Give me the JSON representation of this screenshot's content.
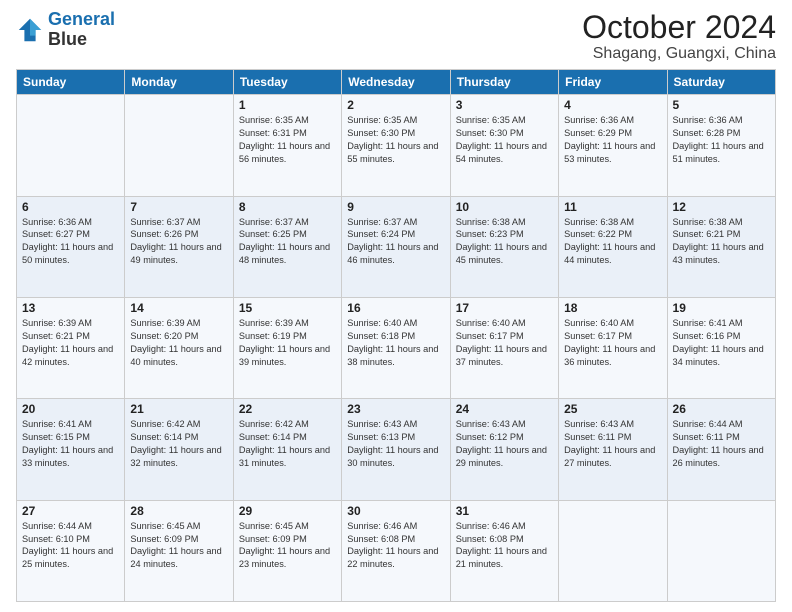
{
  "logo": {
    "line1": "General",
    "line2": "Blue"
  },
  "title": "October 2024",
  "location": "Shagang, Guangxi, China",
  "weekdays": [
    "Sunday",
    "Monday",
    "Tuesday",
    "Wednesday",
    "Thursday",
    "Friday",
    "Saturday"
  ],
  "weeks": [
    [
      {
        "day": "",
        "sunrise": "",
        "sunset": "",
        "daylight": ""
      },
      {
        "day": "",
        "sunrise": "",
        "sunset": "",
        "daylight": ""
      },
      {
        "day": "1",
        "sunrise": "Sunrise: 6:35 AM",
        "sunset": "Sunset: 6:31 PM",
        "daylight": "Daylight: 11 hours and 56 minutes."
      },
      {
        "day": "2",
        "sunrise": "Sunrise: 6:35 AM",
        "sunset": "Sunset: 6:30 PM",
        "daylight": "Daylight: 11 hours and 55 minutes."
      },
      {
        "day": "3",
        "sunrise": "Sunrise: 6:35 AM",
        "sunset": "Sunset: 6:30 PM",
        "daylight": "Daylight: 11 hours and 54 minutes."
      },
      {
        "day": "4",
        "sunrise": "Sunrise: 6:36 AM",
        "sunset": "Sunset: 6:29 PM",
        "daylight": "Daylight: 11 hours and 53 minutes."
      },
      {
        "day": "5",
        "sunrise": "Sunrise: 6:36 AM",
        "sunset": "Sunset: 6:28 PM",
        "daylight": "Daylight: 11 hours and 51 minutes."
      }
    ],
    [
      {
        "day": "6",
        "sunrise": "Sunrise: 6:36 AM",
        "sunset": "Sunset: 6:27 PM",
        "daylight": "Daylight: 11 hours and 50 minutes."
      },
      {
        "day": "7",
        "sunrise": "Sunrise: 6:37 AM",
        "sunset": "Sunset: 6:26 PM",
        "daylight": "Daylight: 11 hours and 49 minutes."
      },
      {
        "day": "8",
        "sunrise": "Sunrise: 6:37 AM",
        "sunset": "Sunset: 6:25 PM",
        "daylight": "Daylight: 11 hours and 48 minutes."
      },
      {
        "day": "9",
        "sunrise": "Sunrise: 6:37 AM",
        "sunset": "Sunset: 6:24 PM",
        "daylight": "Daylight: 11 hours and 46 minutes."
      },
      {
        "day": "10",
        "sunrise": "Sunrise: 6:38 AM",
        "sunset": "Sunset: 6:23 PM",
        "daylight": "Daylight: 11 hours and 45 minutes."
      },
      {
        "day": "11",
        "sunrise": "Sunrise: 6:38 AM",
        "sunset": "Sunset: 6:22 PM",
        "daylight": "Daylight: 11 hours and 44 minutes."
      },
      {
        "day": "12",
        "sunrise": "Sunrise: 6:38 AM",
        "sunset": "Sunset: 6:21 PM",
        "daylight": "Daylight: 11 hours and 43 minutes."
      }
    ],
    [
      {
        "day": "13",
        "sunrise": "Sunrise: 6:39 AM",
        "sunset": "Sunset: 6:21 PM",
        "daylight": "Daylight: 11 hours and 42 minutes."
      },
      {
        "day": "14",
        "sunrise": "Sunrise: 6:39 AM",
        "sunset": "Sunset: 6:20 PM",
        "daylight": "Daylight: 11 hours and 40 minutes."
      },
      {
        "day": "15",
        "sunrise": "Sunrise: 6:39 AM",
        "sunset": "Sunset: 6:19 PM",
        "daylight": "Daylight: 11 hours and 39 minutes."
      },
      {
        "day": "16",
        "sunrise": "Sunrise: 6:40 AM",
        "sunset": "Sunset: 6:18 PM",
        "daylight": "Daylight: 11 hours and 38 minutes."
      },
      {
        "day": "17",
        "sunrise": "Sunrise: 6:40 AM",
        "sunset": "Sunset: 6:17 PM",
        "daylight": "Daylight: 11 hours and 37 minutes."
      },
      {
        "day": "18",
        "sunrise": "Sunrise: 6:40 AM",
        "sunset": "Sunset: 6:17 PM",
        "daylight": "Daylight: 11 hours and 36 minutes."
      },
      {
        "day": "19",
        "sunrise": "Sunrise: 6:41 AM",
        "sunset": "Sunset: 6:16 PM",
        "daylight": "Daylight: 11 hours and 34 minutes."
      }
    ],
    [
      {
        "day": "20",
        "sunrise": "Sunrise: 6:41 AM",
        "sunset": "Sunset: 6:15 PM",
        "daylight": "Daylight: 11 hours and 33 minutes."
      },
      {
        "day": "21",
        "sunrise": "Sunrise: 6:42 AM",
        "sunset": "Sunset: 6:14 PM",
        "daylight": "Daylight: 11 hours and 32 minutes."
      },
      {
        "day": "22",
        "sunrise": "Sunrise: 6:42 AM",
        "sunset": "Sunset: 6:14 PM",
        "daylight": "Daylight: 11 hours and 31 minutes."
      },
      {
        "day": "23",
        "sunrise": "Sunrise: 6:43 AM",
        "sunset": "Sunset: 6:13 PM",
        "daylight": "Daylight: 11 hours and 30 minutes."
      },
      {
        "day": "24",
        "sunrise": "Sunrise: 6:43 AM",
        "sunset": "Sunset: 6:12 PM",
        "daylight": "Daylight: 11 hours and 29 minutes."
      },
      {
        "day": "25",
        "sunrise": "Sunrise: 6:43 AM",
        "sunset": "Sunset: 6:11 PM",
        "daylight": "Daylight: 11 hours and 27 minutes."
      },
      {
        "day": "26",
        "sunrise": "Sunrise: 6:44 AM",
        "sunset": "Sunset: 6:11 PM",
        "daylight": "Daylight: 11 hours and 26 minutes."
      }
    ],
    [
      {
        "day": "27",
        "sunrise": "Sunrise: 6:44 AM",
        "sunset": "Sunset: 6:10 PM",
        "daylight": "Daylight: 11 hours and 25 minutes."
      },
      {
        "day": "28",
        "sunrise": "Sunrise: 6:45 AM",
        "sunset": "Sunset: 6:09 PM",
        "daylight": "Daylight: 11 hours and 24 minutes."
      },
      {
        "day": "29",
        "sunrise": "Sunrise: 6:45 AM",
        "sunset": "Sunset: 6:09 PM",
        "daylight": "Daylight: 11 hours and 23 minutes."
      },
      {
        "day": "30",
        "sunrise": "Sunrise: 6:46 AM",
        "sunset": "Sunset: 6:08 PM",
        "daylight": "Daylight: 11 hours and 22 minutes."
      },
      {
        "day": "31",
        "sunrise": "Sunrise: 6:46 AM",
        "sunset": "Sunset: 6:08 PM",
        "daylight": "Daylight: 11 hours and 21 minutes."
      },
      {
        "day": "",
        "sunrise": "",
        "sunset": "",
        "daylight": ""
      },
      {
        "day": "",
        "sunrise": "",
        "sunset": "",
        "daylight": ""
      }
    ]
  ]
}
